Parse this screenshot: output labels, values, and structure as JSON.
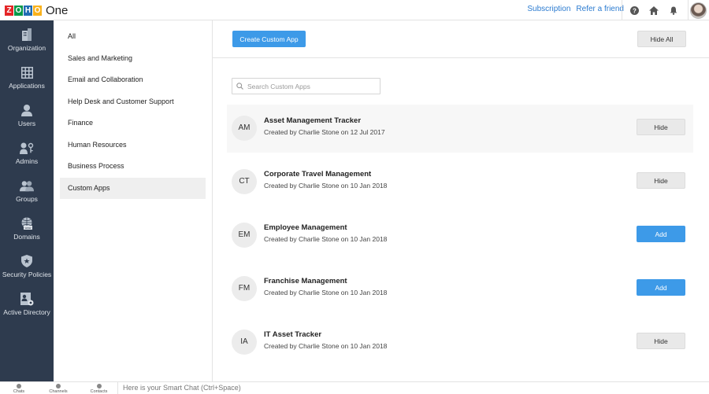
{
  "brand": {
    "logo_letters": [
      "Z",
      "O",
      "H",
      "O"
    ],
    "logo_colors": [
      "#e42527",
      "#089949",
      "#226db4",
      "#f9b21d"
    ],
    "product": "One"
  },
  "header": {
    "subscription_link": "Subscription",
    "refer_link": "Refer a friend",
    "icons": [
      "help-icon",
      "home-icon",
      "bell-icon",
      "user-avatar"
    ]
  },
  "leftnav": {
    "items": [
      {
        "label": "Organization",
        "icon": "building-icon"
      },
      {
        "label": "Applications",
        "icon": "grid-icon"
      },
      {
        "label": "Users",
        "icon": "user-icon"
      },
      {
        "label": "Admins",
        "icon": "admin-key-icon"
      },
      {
        "label": "Groups",
        "icon": "group-icon"
      },
      {
        "label": "Domains",
        "icon": "globe-icon"
      },
      {
        "label": "Security Policies",
        "icon": "shield-icon"
      },
      {
        "label": "Active Directory",
        "icon": "directory-icon"
      }
    ]
  },
  "categories": {
    "items": [
      "All",
      "Sales and Marketing",
      "Email and Collaboration",
      "Help Desk and Customer Support",
      "Finance",
      "Human Resources",
      "Business Process",
      "Custom Apps"
    ],
    "active": "Custom Apps"
  },
  "main": {
    "create_button": "Create Custom App",
    "hide_all_button": "Hide All",
    "search_placeholder": "Search Custom Apps",
    "apps": [
      {
        "initials": "AM",
        "name": "Asset Management Tracker",
        "meta": "Created by Charlie Stone on 12 Jul 2017",
        "action": "Hide"
      },
      {
        "initials": "CT",
        "name": "Corporate Travel Management",
        "meta": "Created by Charlie Stone on 10 Jan 2018",
        "action": "Hide"
      },
      {
        "initials": "EM",
        "name": "Employee Management",
        "meta": "Created by Charlie Stone on 10 Jan 2018",
        "action": "Add"
      },
      {
        "initials": "FM",
        "name": "Franchise Management",
        "meta": "Created by Charlie Stone on 10 Jan 2018",
        "action": "Add"
      },
      {
        "initials": "IA",
        "name": "IT Asset Tracker",
        "meta": "Created by Charlie Stone on 10 Jan 2018",
        "action": "Hide"
      }
    ]
  },
  "bottombar": {
    "tabs": [
      "Chats",
      "Channels",
      "Contacts"
    ],
    "smart_chat_text": "Here is your Smart Chat (Ctrl+Space)"
  },
  "colors": {
    "nav_bg": "#2e3b4e",
    "accent_blue": "#3d9ae8",
    "link_blue": "#2b7bd0"
  }
}
